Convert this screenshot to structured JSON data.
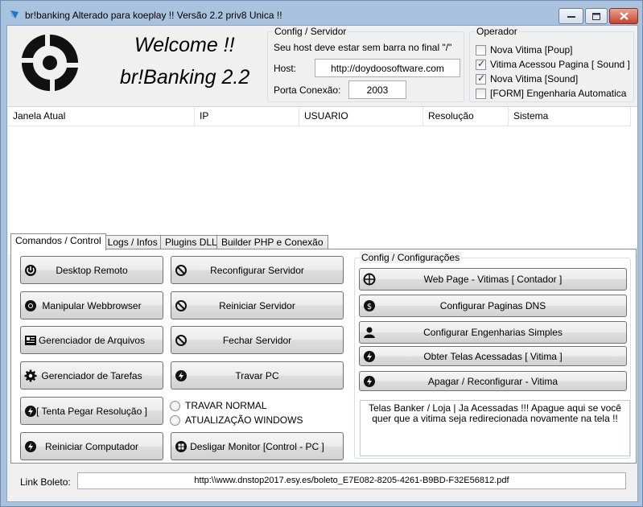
{
  "window": {
    "title": "br!banking Alterado para koeplay !! Versão 2.2 priv8 Unica !!"
  },
  "header": {
    "welcome": "Welcome !!",
    "app_name": "br!Banking 2.2"
  },
  "config_servidor": {
    "title": "Config / Servidor",
    "hint": "Seu host deve estar sem barra no final \"/\"",
    "host_label": "Host:",
    "host_value": "http://doydoosoftware.com",
    "port_label": "Porta Conexão:",
    "port_value": "2003"
  },
  "operador": {
    "title": "Operador",
    "options": [
      {
        "label": "Nova Vitima [Poup]",
        "checked": false
      },
      {
        "label": "Vitima Acessou Pagina [ Sound ]",
        "checked": true
      },
      {
        "label": "Nova Vitima [Sound]",
        "checked": true
      },
      {
        "label": "[FORM] Engenharia Automatica",
        "checked": false
      }
    ]
  },
  "listview": {
    "columns": [
      "Janela Atual",
      "IP",
      "USUARIO",
      "Resolução",
      "Sistema"
    ]
  },
  "tabs": [
    "Comandos / Control",
    "[ Logs / Infos ]",
    "Plugins DLL",
    "Builder PHP e Conexão"
  ],
  "commands_left": [
    {
      "label": "Desktop Remoto",
      "icon": "power-icon"
    },
    {
      "label": "Manipular Webbrowser",
      "icon": "chrome-icon"
    },
    {
      "label": "Gerenciador de Arquivos",
      "icon": "file-manager-icon"
    },
    {
      "label": "Gerenciador de Tarefas",
      "icon": "gear-icon"
    },
    {
      "label": "[ Tenta Pegar Resolução ]",
      "icon": "bolt-icon"
    },
    {
      "label": "Reiniciar Computador",
      "icon": "bolt-icon"
    }
  ],
  "commands_mid": [
    {
      "label": "Reconfigurar Servidor",
      "icon": "block-icon"
    },
    {
      "label": "Reiniciar Servidor",
      "icon": "block-icon"
    },
    {
      "label": "Fechar Servidor",
      "icon": "block-icon"
    },
    {
      "label": "Travar PC",
      "icon": "bolt-icon"
    }
  ],
  "radios": [
    "TRAVAR NORMAL",
    "ATUALIZAÇÃO WINDOWS"
  ],
  "desligar_label": "Desligar Monitor [Control - PC ]",
  "config_configuracoes": {
    "title": "Config / Configurações",
    "buttons": [
      {
        "label": "Web Page - Vitimas [ Contador ]",
        "icon": "globe-icon"
      },
      {
        "label": "Configurar Paginas DNS",
        "icon": "dollar-icon"
      },
      {
        "label": "Configurar Engenharias Simples",
        "icon": "user-icon"
      },
      {
        "label": "Obter Telas Acessadas [ Vitima ]",
        "icon": "bolt-icon"
      },
      {
        "label": "Apagar / Reconfigurar - Vitima",
        "icon": "bolt-icon"
      }
    ],
    "message": "Telas Banker / Loja | Ja Acessadas !!! Apague aqui se você quer que a vitima seja redirecionada novamente na tela !!"
  },
  "boleto": {
    "label": "Link Boleto:",
    "value": "http:\\\\www.dnstop2017.esy.es/boleto_E7E082-8205-4261-B9BD-F32E56812.pdf"
  }
}
